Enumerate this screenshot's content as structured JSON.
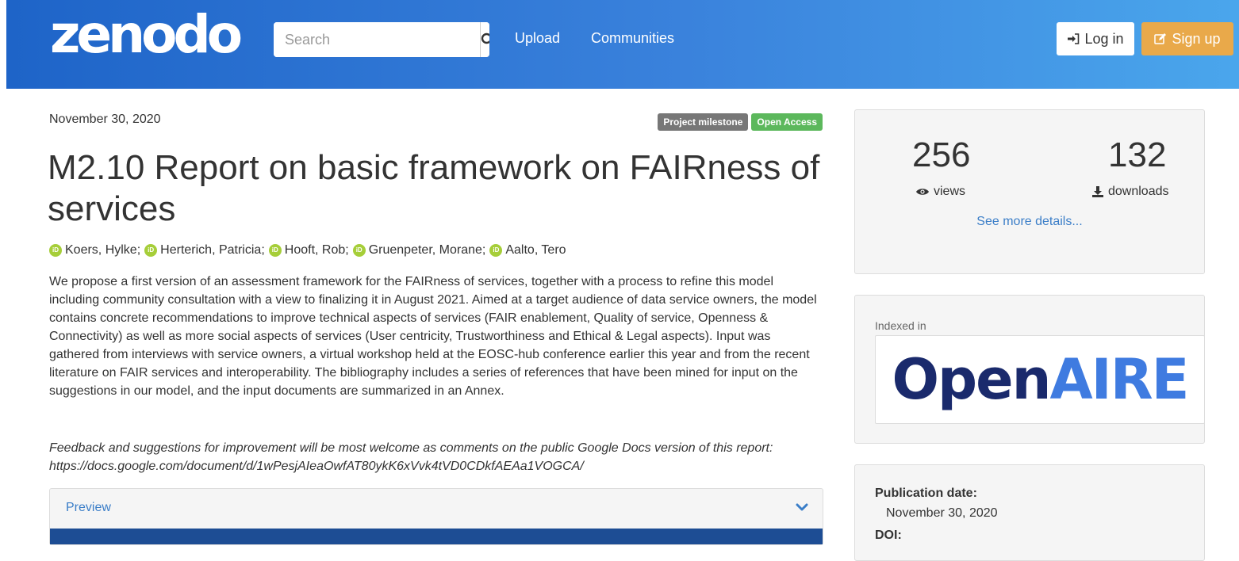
{
  "header": {
    "logo": "zenodo",
    "search_placeholder": "Search",
    "nav": {
      "upload": "Upload",
      "communities": "Communities"
    },
    "login": "Log in",
    "signup": "Sign up"
  },
  "record": {
    "date": "November 30, 2020",
    "badges": [
      {
        "label": "Project milestone",
        "color": "#777777"
      },
      {
        "label": "Open Access",
        "color": "#5cb85c"
      }
    ],
    "title": "M2.10 Report on basic framework on FAIRness of services",
    "authors": [
      "Koers, Hylke",
      "Herterich, Patricia",
      "Hooft, Rob",
      "Gruenpeter, Morane",
      "Aalto, Tero"
    ],
    "author_separator": ";",
    "orcid_icon_text": "iD",
    "abstract": "We propose a first version of an assessment framework for the FAIRness of services, together with a process to refine this model including community consultation with a view to finalizing it in August 2021. Aimed at a target audience of data service owners, the model contains concrete recommendations to improve technical aspects of services (FAIR enablement, Quality of service, Openness & Connectivity) as well as more social aspects of services (User centricity, Trustworthiness and Ethical & Legal aspects). Input was gathered from interviews with service owners, a virtual workshop held at the EOSC-hub conference earlier this year and from the recent literature on FAIR services and interoperability. The bibliography includes a series of references that have been mined for input on the suggestions in our model, and the input documents are summarized in an Annex.",
    "feedback": "Feedback and suggestions for improvement will be most welcome as comments on the public Google Docs version of this report: https://docs.google.com/document/d/1wPesjAIeaOwfAT80ykK6xVvk4tVD0CDkfAEAa1VOGCA/",
    "preview_label": "Preview"
  },
  "sidebar": {
    "views": {
      "count": "256",
      "label": "views"
    },
    "downloads": {
      "count": "132",
      "label": "downloads"
    },
    "see_more": "See more details...",
    "indexed_in": "Indexed in",
    "openaire": {
      "part1": "Open",
      "part2": "AIRE",
      "color1": "#1a2a6c",
      "color2": "#3f7be0"
    },
    "publication_date_label": "Publication date:",
    "publication_date": "November 30, 2020",
    "next_label": "DOI:"
  },
  "colors": {
    "header_start": "#1e64c8",
    "header_end": "#4aa6ec",
    "link": "#3b7ec8",
    "signup": "#e9a94a",
    "orcid": "#a6ce39"
  }
}
